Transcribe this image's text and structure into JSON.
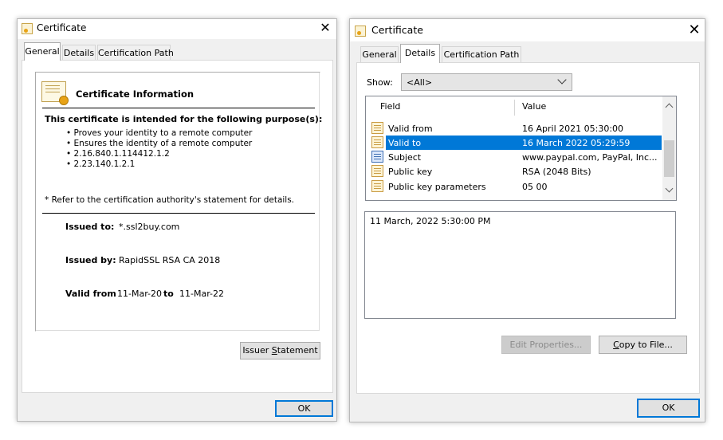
{
  "left_dialog": {
    "title": "Certificate",
    "close_glyph": "✕",
    "tabs": [
      "General",
      "Details",
      "Certification Path"
    ],
    "active_tab": "General",
    "info_heading": "Certificate Information",
    "purpose_heading": "This certificate is intended for the following purpose(s):",
    "purposes": [
      "Proves your identity to a remote computer",
      "Ensures the identity of a remote computer",
      "2.16.840.1.114412.1.2",
      "2.23.140.1.2.1"
    ],
    "refer_note": "* Refer to the certification authority's statement for details.",
    "issued_to_label": "Issued to:",
    "issued_to_value": "*.ssl2buy.com",
    "issued_by_label": "Issued by:",
    "issued_by_value": "RapidSSL RSA CA 2018",
    "valid_from_label": "Valid from",
    "valid_from_value": "11-Mar-20",
    "valid_to_label": "to",
    "valid_to_value": "11-Mar-22",
    "issuer_statement_pre": "Issuer ",
    "issuer_statement_key": "S",
    "issuer_statement_post": "tatement",
    "ok_label": "OK"
  },
  "right_dialog": {
    "title": "Certificate",
    "close_glyph": "✕",
    "tabs": [
      "General",
      "Details",
      "Certification Path"
    ],
    "active_tab": "Details",
    "show_label": "Show:",
    "show_value": "<All>",
    "columns": [
      "Field",
      "Value"
    ],
    "rows": [
      {
        "field": "Valid from",
        "value": "16 April 2021 05:30:00",
        "icon": "certificate-field-icon"
      },
      {
        "field": "Valid to",
        "value": "16 March 2022 05:29:59",
        "icon": "certificate-field-icon",
        "selected": true
      },
      {
        "field": "Subject",
        "value": "www.paypal.com, PayPal, Inc...",
        "icon": "certificate-subject-icon"
      },
      {
        "field": "Public key",
        "value": "RSA (2048 Bits)",
        "icon": "certificate-field-icon"
      },
      {
        "field": "Public key parameters",
        "value": "05 00",
        "icon": "certificate-field-icon"
      }
    ],
    "detail_text": "11 March, 2022 5:30:00 PM",
    "edit_properties_label": "Edit Properties...",
    "copy_pre": "",
    "copy_key": "C",
    "copy_post": "opy to File...",
    "ok_label": "OK"
  },
  "colors": {
    "selection": "#0078d7",
    "dialog_background": "#f0f0f0",
    "default_button_border": "#0078d7"
  }
}
